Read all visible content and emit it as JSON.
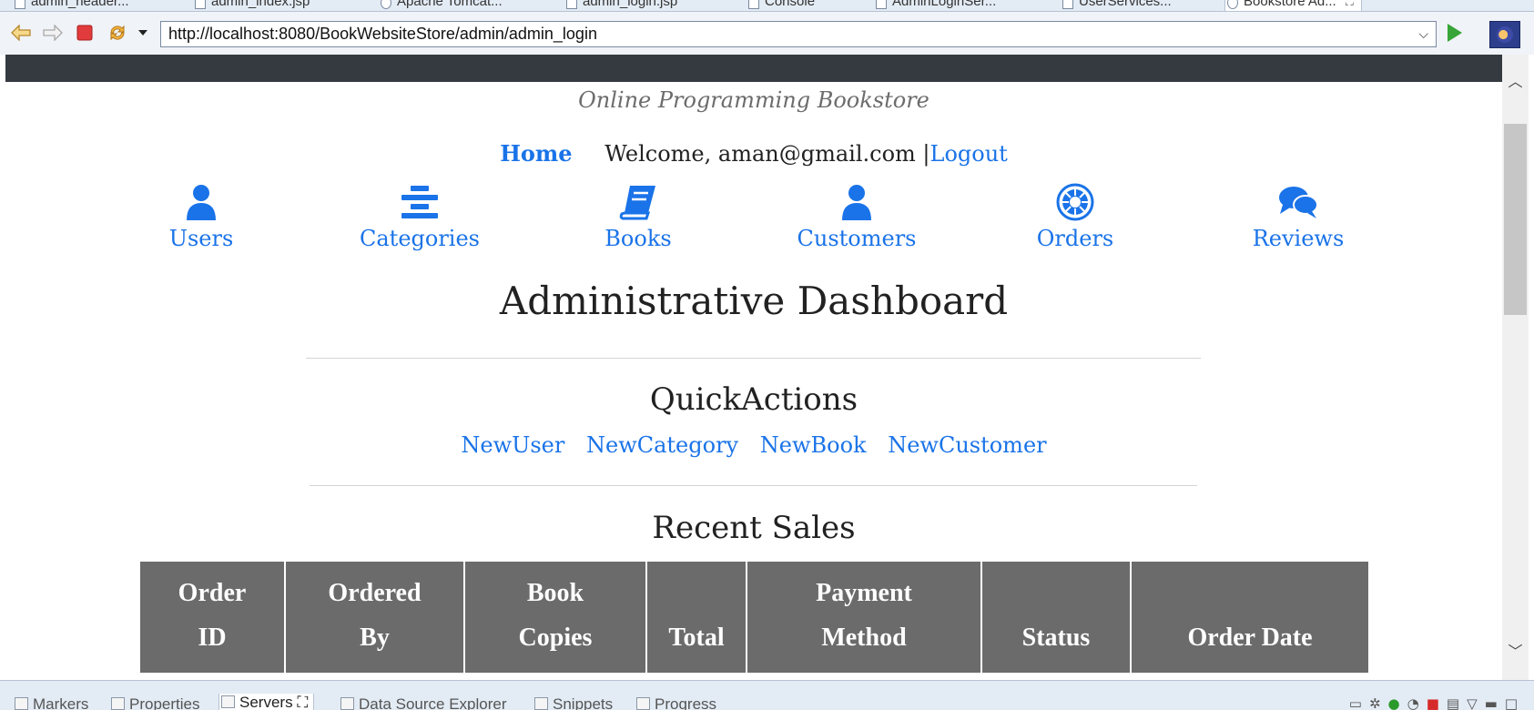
{
  "editor_tabs": [
    {
      "label": "admin_header..."
    },
    {
      "label": "admin_index.jsp"
    },
    {
      "label": "Apache Tomcat..."
    },
    {
      "label": "admin_login.jsp"
    },
    {
      "label": "Console"
    },
    {
      "label": "AdminLoginSer..."
    },
    {
      "label": "UserServices..."
    },
    {
      "label": "Bookstore Ad...",
      "close": "⛶"
    }
  ],
  "browser": {
    "url": "http://localhost:8080/BookWebsiteStore/admin/admin_login"
  },
  "page": {
    "tagline": "Online Programming Bookstore",
    "home_link": "Home",
    "welcome": "Welcome, aman@gmail.com |",
    "logout_link": "Logout",
    "nav": [
      {
        "label": "Users",
        "icon": "user-icon"
      },
      {
        "label": "Categories",
        "icon": "align-center-icon"
      },
      {
        "label": "Books",
        "icon": "book-icon"
      },
      {
        "label": "Customers",
        "icon": "user-icon"
      },
      {
        "label": "Orders",
        "icon": "empire-icon"
      },
      {
        "label": "Reviews",
        "icon": "comments-icon"
      }
    ],
    "title": "Administrative Dashboard",
    "quick_actions_title": "QuickActions",
    "quick_actions": [
      "NewUser",
      "NewCategory",
      "NewBook",
      "NewCustomer"
    ],
    "recent_sales_title": "Recent Sales",
    "sales_table": {
      "headers": [
        {
          "line1": "Order",
          "line2": "ID"
        },
        {
          "line1": "Ordered",
          "line2": "By"
        },
        {
          "line1": "Book",
          "line2": "Copies"
        },
        {
          "line1": "",
          "line2": "Total"
        },
        {
          "line1": "Payment",
          "line2": "Method"
        },
        {
          "line1": "",
          "line2": "Status"
        },
        {
          "line1": "",
          "line2": "Order Date"
        }
      ]
    }
  },
  "bottom_tabs": [
    {
      "label": "Markers"
    },
    {
      "label": "Properties"
    },
    {
      "label": "Servers",
      "close": "⛶"
    },
    {
      "label": "Data Source Explorer"
    },
    {
      "label": "Snippets"
    },
    {
      "label": "Progress"
    }
  ],
  "colors": {
    "link": "#1a73e8",
    "header_dark": "#343a40",
    "table_header": "#6b6b6b"
  }
}
